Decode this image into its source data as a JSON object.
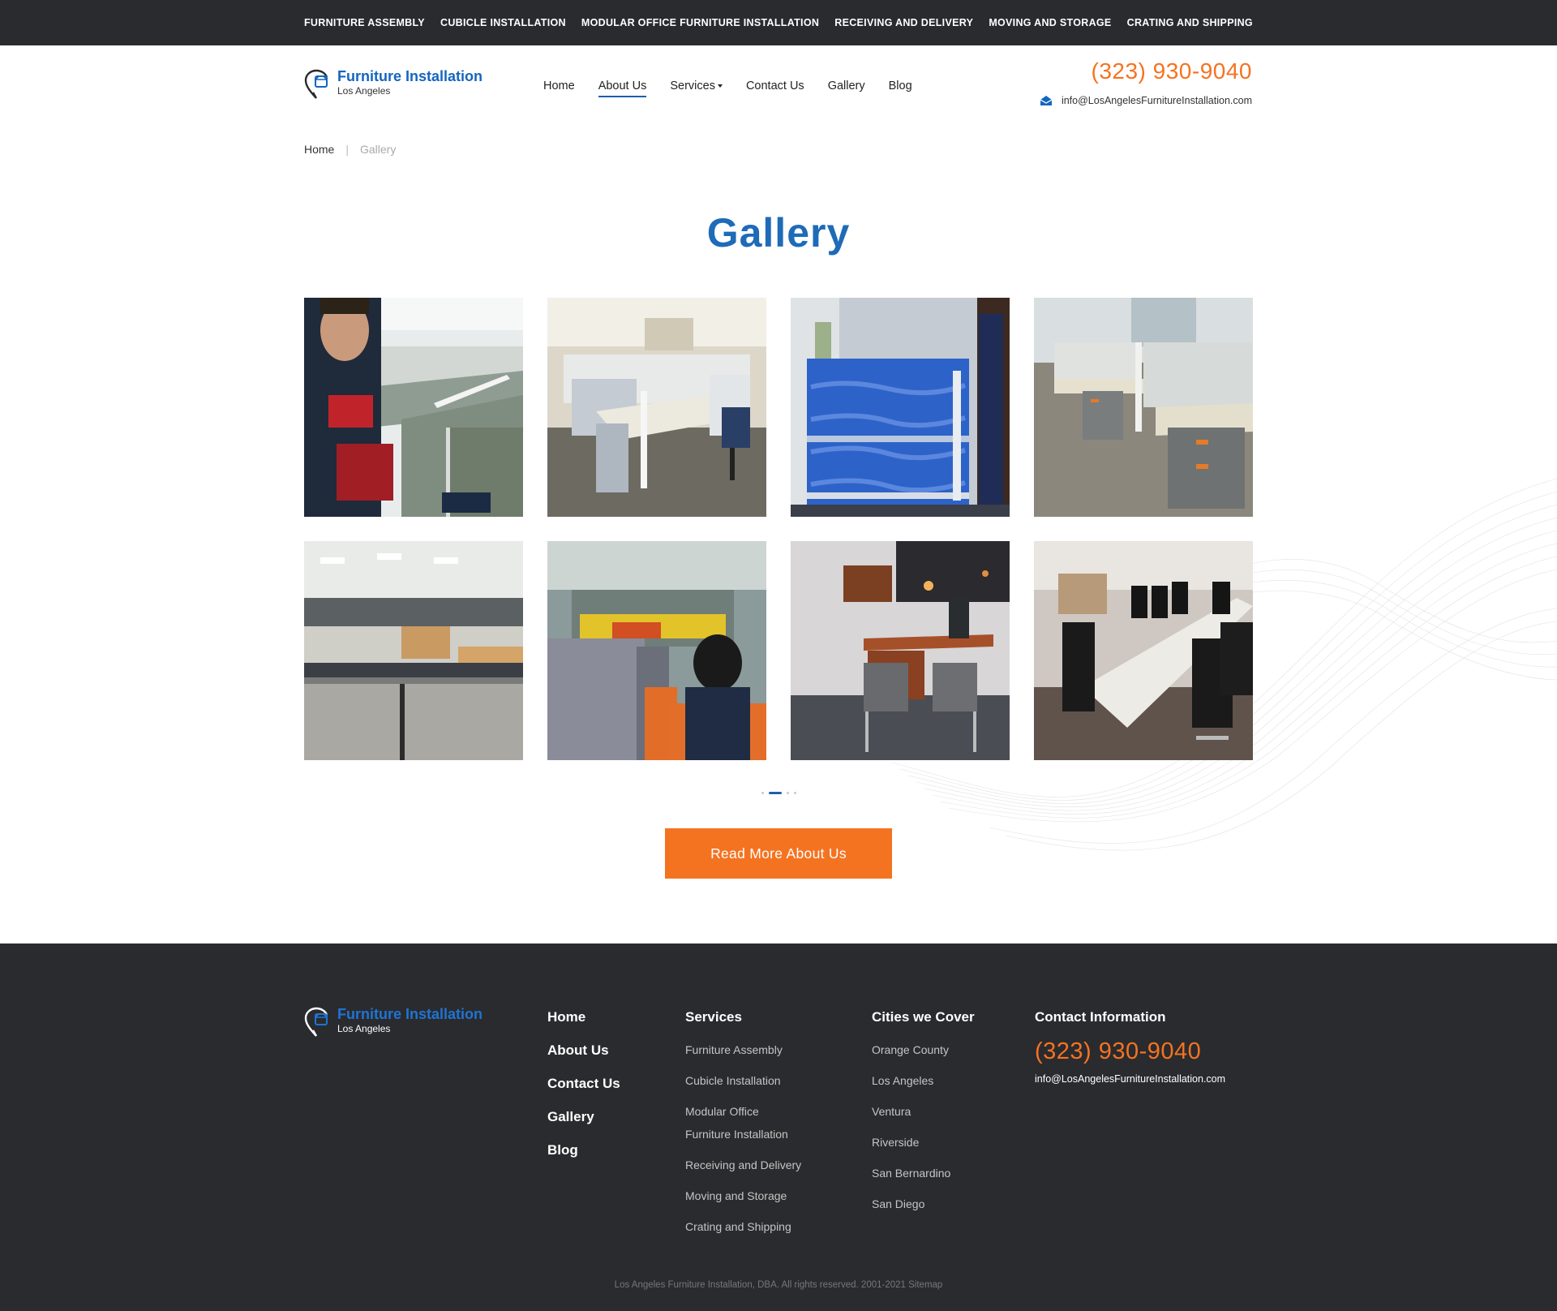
{
  "topbar": {
    "links": [
      "FURNITURE ASSEMBLY",
      "CUBICLE INSTALLATION",
      "MODULAR OFFICE FURNITURE INSTALLATION",
      "RECEIVING AND DELIVERY",
      "MOVING AND STORAGE",
      "CRATING AND SHIPPING"
    ]
  },
  "brand": {
    "name": "Furniture Installation",
    "city": "Los Angeles",
    "icon": "location-pin-box-icon",
    "color": "#1565c0"
  },
  "nav": {
    "items": [
      "Home",
      "About Us",
      "Services",
      "Contact Us",
      "Gallery",
      "Blog"
    ],
    "active": "About Us"
  },
  "contact": {
    "phone": "(323) 930-9040",
    "email": "info@LosAngelesFurnitureInstallation.com"
  },
  "breadcrumb": {
    "home": "Home",
    "separator": "|",
    "current": "Gallery"
  },
  "page": {
    "title": "Gallery"
  },
  "gallery": {
    "photos": [
      "worker-installing-cubicle-panels",
      "white-cubicle-workstations",
      "furniture-wrapped-in-blue-moving-blankets",
      "gray-cubicle-desk-with-file-cabinets",
      "open-office-cubicle-rows",
      "worker-in-warehouse",
      "private-office-l-desk",
      "conference-table-with-black-chairs"
    ],
    "pagination": {
      "pages": 4,
      "active_page": 2
    }
  },
  "cta": {
    "label": "Read More About Us"
  },
  "footer": {
    "main_links": [
      "Home",
      "About Us",
      "Contact Us",
      "Gallery",
      "Blog"
    ],
    "services": {
      "heading": "Services",
      "items": [
        "Furniture Assembly",
        "Cubicle Installation",
        "Modular Office",
        "Furniture Installation",
        "Receiving and Delivery",
        "Moving and Storage",
        "Crating and Shipping"
      ]
    },
    "cities": {
      "heading": "Cities we Cover",
      "items": [
        "Orange County",
        "Los Angeles",
        "Ventura",
        "Riverside",
        "San Bernardino",
        "San Diego"
      ]
    },
    "contact": {
      "heading": "Contact Information",
      "phone": "(323) 930-9040",
      "email": "info@LosAngelesFurnitureInstallation.com"
    },
    "copyright": "Los Angeles Furniture Installation, DBA. All rights reserved. 2001-2021 Sitemap"
  },
  "colors": {
    "accent_orange": "#f47321",
    "title_blue": "#1e6bb8",
    "dark_bar": "#2a2b2e"
  }
}
